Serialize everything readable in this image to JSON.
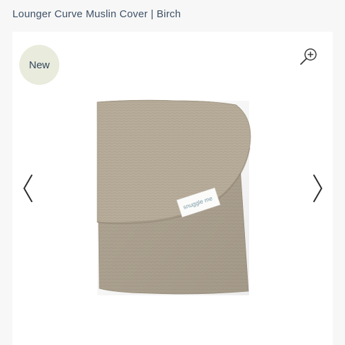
{
  "product": {
    "title": "Lounger Curve Muslin Cover | Birch"
  },
  "gallery": {
    "badge_label": "New",
    "zoom_icon": "zoom-in-icon",
    "prev_icon": "chevron-left-icon",
    "next_icon": "chevron-right-icon",
    "tag_text": "snuggle me"
  },
  "colors": {
    "title_text": "#3e5066",
    "badge_bg": "#e9ebdc",
    "fabric": "#b3a896",
    "background": "#f7f7f7"
  }
}
